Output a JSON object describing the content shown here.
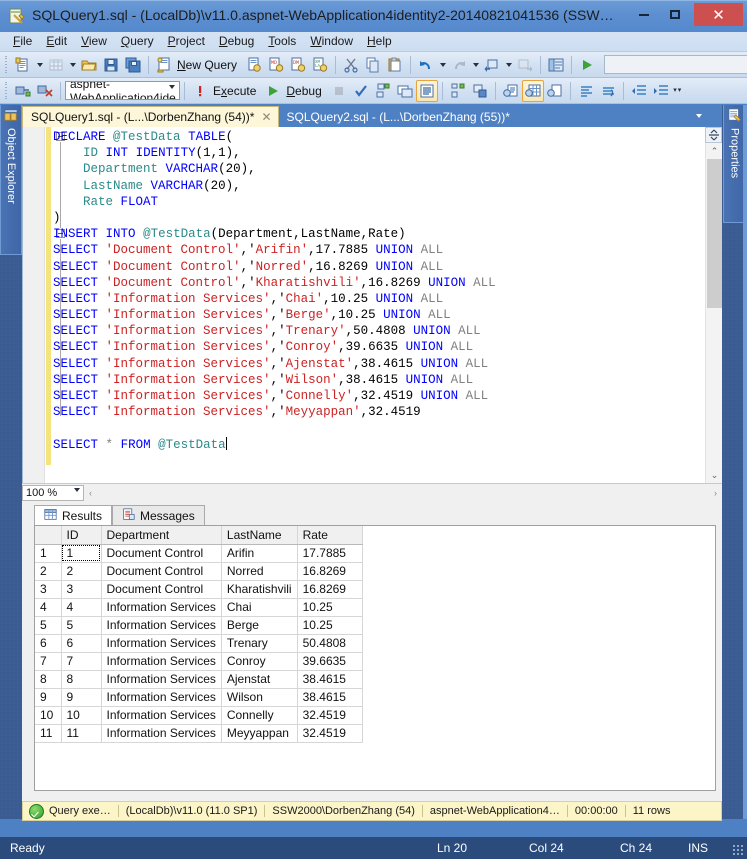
{
  "window": {
    "title": "SQLQuery1.sql - (LocalDb)\\v11.0.aspnet-WebApplication4identity2-20140821041536 (SSW…",
    "app_icon": "sql-query-file-icon",
    "minimize": "−",
    "maximize": "▢",
    "close": "✕"
  },
  "menu": {
    "items": [
      {
        "label": "File"
      },
      {
        "label": "Edit"
      },
      {
        "label": "View"
      },
      {
        "label": "Query"
      },
      {
        "label": "Project"
      },
      {
        "label": "Debug"
      },
      {
        "label": "Tools"
      },
      {
        "label": "Window"
      },
      {
        "label": "Help"
      }
    ]
  },
  "toolbar_standard": {
    "new_query_label": "New Query",
    "database_combo_value": "",
    "buttons": [
      {
        "name": "new-query-dropdown-button",
        "icon": "new-document-icon"
      },
      {
        "name": "new-table-button",
        "icon": "table-icon"
      },
      {
        "name": "open-file-button",
        "icon": "open-folder-icon"
      },
      {
        "name": "save-button",
        "icon": "floppy-disk-icon"
      },
      {
        "name": "save-all-button",
        "icon": "save-all-icon"
      },
      {
        "name": "new-query-button",
        "icon": "new-query-icon"
      },
      {
        "name": "new-database-engine-query-button",
        "icon": "db-query-icon"
      },
      {
        "name": "new-analysis-services-mdx-query-button",
        "icon": "mdx-query-icon"
      },
      {
        "name": "new-analysis-services-dmx-query-button",
        "icon": "dmx-query-icon"
      },
      {
        "name": "new-analysis-services-xmla-query-button",
        "icon": "xmla-query-icon"
      },
      {
        "name": "cut-button",
        "icon": "scissors-icon"
      },
      {
        "name": "copy-button",
        "icon": "copy-icon"
      },
      {
        "name": "paste-button",
        "icon": "paste-icon"
      },
      {
        "name": "undo-button",
        "icon": "undo-arrow-icon"
      },
      {
        "name": "redo-button",
        "icon": "redo-arrow-icon"
      },
      {
        "name": "navigate-backward-button",
        "icon": "navigate-back-icon"
      },
      {
        "name": "navigate-forward-button",
        "icon": "navigate-forward-icon"
      },
      {
        "name": "show-object-explorer-button",
        "icon": "object-explorer-icon"
      },
      {
        "name": "run-button",
        "icon": "green-play-icon"
      }
    ]
  },
  "toolbar_sql_editor": {
    "database_combo_value": "aspnet-WebApplication4ide",
    "execute_label": "Execute",
    "debug_label": "Debug",
    "buttons": [
      {
        "name": "connect-button",
        "icon": "connect-plug-icon"
      },
      {
        "name": "disconnect-button",
        "icon": "disconnect-plug-icon"
      },
      {
        "name": "parse-query-button",
        "icon": "red-exclamation-icon"
      },
      {
        "name": "stop-button",
        "icon": "stop-square-icon"
      },
      {
        "name": "parse-check-button",
        "icon": "blue-check-icon"
      },
      {
        "name": "display-estimated-execution-plan-button",
        "icon": "estimated-plan-icon"
      },
      {
        "name": "query-options-button",
        "icon": "query-options-icon"
      },
      {
        "name": "include-actual-execution-plan-button",
        "icon": "actual-plan-icon"
      },
      {
        "name": "include-client-statistics-button",
        "icon": "client-statistics-icon"
      },
      {
        "name": "include-live-query-statistics-button",
        "icon": "live-statistics-icon"
      },
      {
        "name": "results-to-text-button",
        "icon": "results-to-text-icon"
      },
      {
        "name": "results-to-grid-button",
        "icon": "results-to-grid-icon"
      },
      {
        "name": "results-to-file-button",
        "icon": "results-to-file-icon"
      },
      {
        "name": "comment-lines-button",
        "icon": "comment-lines-icon"
      },
      {
        "name": "uncomment-lines-button",
        "icon": "uncomment-lines-icon"
      },
      {
        "name": "decrease-indent-button",
        "icon": "decrease-indent-icon"
      },
      {
        "name": "increase-indent-button",
        "icon": "increase-indent-icon"
      }
    ]
  },
  "dock_left": {
    "label": "Object Explorer",
    "icon": "object-explorer-icon"
  },
  "dock_right": {
    "label": "Properties",
    "icon": "properties-window-icon"
  },
  "tabs": [
    {
      "label": "SQLQuery1.sql - (L...\\DorbenZhang (54))*",
      "active": true,
      "close": "✕"
    },
    {
      "label": "SQLQuery2.sql - (L...\\DorbenZhang (55))*",
      "active": false
    }
  ],
  "editor": {
    "zoom": "100 %",
    "code_lines": [
      [
        {
          "t": "k",
          "x": "DECLARE"
        },
        {
          "t": "n",
          "x": " "
        },
        {
          "t": "t",
          "x": "@TestData"
        },
        {
          "t": "n",
          "x": " "
        },
        {
          "t": "k",
          "x": "TABLE"
        },
        {
          "t": "n",
          "x": "("
        }
      ],
      [
        {
          "t": "n",
          "x": "    "
        },
        {
          "t": "t",
          "x": "ID"
        },
        {
          "t": "n",
          "x": " "
        },
        {
          "t": "k",
          "x": "INT"
        },
        {
          "t": "n",
          "x": " "
        },
        {
          "t": "k",
          "x": "IDENTITY"
        },
        {
          "t": "n",
          "x": "(1,1),"
        }
      ],
      [
        {
          "t": "n",
          "x": "    "
        },
        {
          "t": "t",
          "x": "Department"
        },
        {
          "t": "n",
          "x": " "
        },
        {
          "t": "k",
          "x": "VARCHAR"
        },
        {
          "t": "n",
          "x": "(20),"
        }
      ],
      [
        {
          "t": "n",
          "x": "    "
        },
        {
          "t": "t",
          "x": "LastName"
        },
        {
          "t": "n",
          "x": " "
        },
        {
          "t": "k",
          "x": "VARCHAR"
        },
        {
          "t": "n",
          "x": "(20),"
        }
      ],
      [
        {
          "t": "n",
          "x": "    "
        },
        {
          "t": "t",
          "x": "Rate"
        },
        {
          "t": "n",
          "x": " "
        },
        {
          "t": "k",
          "x": "FLOAT"
        }
      ],
      [
        {
          "t": "n",
          "x": ")"
        }
      ],
      [
        {
          "t": "k",
          "x": "INSERT"
        },
        {
          "t": "n",
          "x": " "
        },
        {
          "t": "k",
          "x": "INTO"
        },
        {
          "t": "n",
          "x": " "
        },
        {
          "t": "t",
          "x": "@TestData"
        },
        {
          "t": "n",
          "x": "(Department,LastName,Rate)"
        }
      ],
      [
        {
          "t": "k",
          "x": "SELECT"
        },
        {
          "t": "n",
          "x": " "
        },
        {
          "t": "s",
          "x": "'Document Control'"
        },
        {
          "t": "n",
          "x": ",'"
        },
        {
          "t": "s",
          "x": "Arifin'"
        },
        {
          "t": "n",
          "x": ",17.7885 "
        },
        {
          "t": "k",
          "x": "UNION"
        },
        {
          "t": "n",
          "x": " "
        },
        {
          "t": "g",
          "x": "ALL"
        }
      ],
      [
        {
          "t": "k",
          "x": "SELECT"
        },
        {
          "t": "n",
          "x": " "
        },
        {
          "t": "s",
          "x": "'Document Control'"
        },
        {
          "t": "n",
          "x": ",'"
        },
        {
          "t": "s",
          "x": "Norred'"
        },
        {
          "t": "n",
          "x": ",16.8269 "
        },
        {
          "t": "k",
          "x": "UNION"
        },
        {
          "t": "n",
          "x": " "
        },
        {
          "t": "g",
          "x": "ALL"
        }
      ],
      [
        {
          "t": "k",
          "x": "SELECT"
        },
        {
          "t": "n",
          "x": " "
        },
        {
          "t": "s",
          "x": "'Document Control'"
        },
        {
          "t": "n",
          "x": ",'"
        },
        {
          "t": "s",
          "x": "Kharatishvili'"
        },
        {
          "t": "n",
          "x": ",16.8269 "
        },
        {
          "t": "k",
          "x": "UNION"
        },
        {
          "t": "n",
          "x": " "
        },
        {
          "t": "g",
          "x": "ALL"
        }
      ],
      [
        {
          "t": "k",
          "x": "SELECT"
        },
        {
          "t": "n",
          "x": " "
        },
        {
          "t": "s",
          "x": "'Information Services'"
        },
        {
          "t": "n",
          "x": ",'"
        },
        {
          "t": "s",
          "x": "Chai'"
        },
        {
          "t": "n",
          "x": ",10.25 "
        },
        {
          "t": "k",
          "x": "UNION"
        },
        {
          "t": "n",
          "x": " "
        },
        {
          "t": "g",
          "x": "ALL"
        }
      ],
      [
        {
          "t": "k",
          "x": "SELECT"
        },
        {
          "t": "n",
          "x": " "
        },
        {
          "t": "s",
          "x": "'Information Services'"
        },
        {
          "t": "n",
          "x": ",'"
        },
        {
          "t": "s",
          "x": "Berge'"
        },
        {
          "t": "n",
          "x": ",10.25 "
        },
        {
          "t": "k",
          "x": "UNION"
        },
        {
          "t": "n",
          "x": " "
        },
        {
          "t": "g",
          "x": "ALL"
        }
      ],
      [
        {
          "t": "k",
          "x": "SELECT"
        },
        {
          "t": "n",
          "x": " "
        },
        {
          "t": "s",
          "x": "'Information Services'"
        },
        {
          "t": "n",
          "x": ",'"
        },
        {
          "t": "s",
          "x": "Trenary'"
        },
        {
          "t": "n",
          "x": ",50.4808 "
        },
        {
          "t": "k",
          "x": "UNION"
        },
        {
          "t": "n",
          "x": " "
        },
        {
          "t": "g",
          "x": "ALL"
        }
      ],
      [
        {
          "t": "k",
          "x": "SELECT"
        },
        {
          "t": "n",
          "x": " "
        },
        {
          "t": "s",
          "x": "'Information Services'"
        },
        {
          "t": "n",
          "x": ",'"
        },
        {
          "t": "s",
          "x": "Conroy'"
        },
        {
          "t": "n",
          "x": ",39.6635 "
        },
        {
          "t": "k",
          "x": "UNION"
        },
        {
          "t": "n",
          "x": " "
        },
        {
          "t": "g",
          "x": "ALL"
        }
      ],
      [
        {
          "t": "k",
          "x": "SELECT"
        },
        {
          "t": "n",
          "x": " "
        },
        {
          "t": "s",
          "x": "'Information Services'"
        },
        {
          "t": "n",
          "x": ",'"
        },
        {
          "t": "s",
          "x": "Ajenstat'"
        },
        {
          "t": "n",
          "x": ",38.4615 "
        },
        {
          "t": "k",
          "x": "UNION"
        },
        {
          "t": "n",
          "x": " "
        },
        {
          "t": "g",
          "x": "ALL"
        }
      ],
      [
        {
          "t": "k",
          "x": "SELECT"
        },
        {
          "t": "n",
          "x": " "
        },
        {
          "t": "s",
          "x": "'Information Services'"
        },
        {
          "t": "n",
          "x": ",'"
        },
        {
          "t": "s",
          "x": "Wilson'"
        },
        {
          "t": "n",
          "x": ",38.4615 "
        },
        {
          "t": "k",
          "x": "UNION"
        },
        {
          "t": "n",
          "x": " "
        },
        {
          "t": "g",
          "x": "ALL"
        }
      ],
      [
        {
          "t": "k",
          "x": "SELECT"
        },
        {
          "t": "n",
          "x": " "
        },
        {
          "t": "s",
          "x": "'Information Services'"
        },
        {
          "t": "n",
          "x": ",'"
        },
        {
          "t": "s",
          "x": "Connelly'"
        },
        {
          "t": "n",
          "x": ",32.4519 "
        },
        {
          "t": "k",
          "x": "UNION"
        },
        {
          "t": "n",
          "x": " "
        },
        {
          "t": "g",
          "x": "ALL"
        }
      ],
      [
        {
          "t": "k",
          "x": "SELECT"
        },
        {
          "t": "n",
          "x": " "
        },
        {
          "t": "s",
          "x": "'Information Services'"
        },
        {
          "t": "n",
          "x": ",'"
        },
        {
          "t": "s",
          "x": "Meyyappan'"
        },
        {
          "t": "n",
          "x": ",32.4519"
        }
      ],
      [],
      [
        {
          "t": "k",
          "x": "SELECT"
        },
        {
          "t": "n",
          "x": " "
        },
        {
          "t": "g",
          "x": "*"
        },
        {
          "t": "n",
          "x": " "
        },
        {
          "t": "k",
          "x": "FROM"
        },
        {
          "t": "n",
          "x": " "
        },
        {
          "t": "t",
          "x": "@TestData"
        }
      ]
    ]
  },
  "results": {
    "tabs": [
      {
        "label": "Results",
        "icon": "grid-icon",
        "active": true
      },
      {
        "label": "Messages",
        "icon": "messages-icon",
        "active": false
      }
    ],
    "columns": [
      "",
      "ID",
      "Department",
      "LastName",
      "Rate"
    ],
    "rows": [
      {
        "n": "1",
        "id": "1",
        "department": "Document Control",
        "lastname": "Arifin",
        "rate": "17.7885"
      },
      {
        "n": "2",
        "id": "2",
        "department": "Document Control",
        "lastname": "Norred",
        "rate": "16.8269"
      },
      {
        "n": "3",
        "id": "3",
        "department": "Document Control",
        "lastname": "Kharatishvili",
        "rate": "16.8269"
      },
      {
        "n": "4",
        "id": "4",
        "department": "Information Services",
        "lastname": "Chai",
        "rate": "10.25"
      },
      {
        "n": "5",
        "id": "5",
        "department": "Information Services",
        "lastname": "Berge",
        "rate": "10.25"
      },
      {
        "n": "6",
        "id": "6",
        "department": "Information Services",
        "lastname": "Trenary",
        "rate": "50.4808"
      },
      {
        "n": "7",
        "id": "7",
        "department": "Information Services",
        "lastname": "Conroy",
        "rate": "39.6635"
      },
      {
        "n": "8",
        "id": "8",
        "department": "Information Services",
        "lastname": "Ajenstat",
        "rate": "38.4615"
      },
      {
        "n": "9",
        "id": "9",
        "department": "Information Services",
        "lastname": "Wilson",
        "rate": "38.4615"
      },
      {
        "n": "10",
        "id": "10",
        "department": "Information Services",
        "lastname": "Connelly",
        "rate": "32.4519"
      },
      {
        "n": "11",
        "id": "11",
        "department": "Information Services",
        "lastname": "Meyyappan",
        "rate": "32.4519"
      }
    ]
  },
  "query_status": {
    "state": "Query exe…",
    "server": "(LocalDb)\\v11.0 (11.0 SP1)",
    "user": "SSW2000\\DorbenZhang (54)",
    "database": "aspnet-WebApplication4…",
    "elapsed": "00:00:00",
    "rowcount": "11 rows"
  },
  "status_bar": {
    "ready": "Ready",
    "line": "Ln 20",
    "col": "Col 24",
    "ch": "Ch 24",
    "insert_mode": "INS"
  }
}
